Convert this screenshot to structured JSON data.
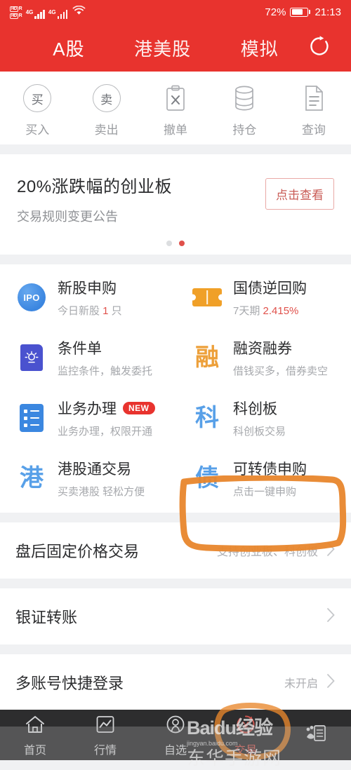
{
  "status_bar": {
    "volte_label": "HD",
    "volte_sub": "R",
    "network_1": "4G",
    "network_2": "4G",
    "wifi_icon": "wifi-icon",
    "battery_percent": "72%",
    "battery_level": 72,
    "time": "21:13"
  },
  "header": {
    "brand_color": "#e8332e",
    "tabs": [
      {
        "label": "A股",
        "active": true
      },
      {
        "label": "港美股",
        "active": false
      },
      {
        "label": "模拟",
        "active": false
      }
    ],
    "refresh_icon": "refresh-icon"
  },
  "quick_actions": [
    {
      "label": "买入",
      "glyph": "买",
      "icon": "buy-circle-icon"
    },
    {
      "label": "卖出",
      "glyph": "卖",
      "icon": "sell-circle-icon"
    },
    {
      "label": "撤单",
      "glyph": "",
      "icon": "cancel-order-clipboard-icon"
    },
    {
      "label": "持仓",
      "glyph": "",
      "icon": "holdings-database-icon"
    },
    {
      "label": "查询",
      "glyph": "",
      "icon": "query-document-icon"
    }
  ],
  "banner": {
    "title": "20%涨跌幅的创业板",
    "subtitle": "交易规则变更公告",
    "button_label": "点击查看",
    "button_border_color": "#e9a9a6",
    "button_text_color": "#c95b55",
    "dots": {
      "total": 2,
      "active_index": 1,
      "active_color": "#e0514b"
    }
  },
  "services": [
    {
      "title": "新股申购",
      "sub_prefix": "今日新股 ",
      "sub_highlight": "1",
      "sub_suffix": " 只",
      "icon": "ipo-icon",
      "icon_text": "IPO",
      "icon_color": "#3b86e0",
      "badge": ""
    },
    {
      "title": "国债逆回购",
      "sub_prefix": "7天期 ",
      "sub_highlight": "2.415%",
      "sub_suffix": "",
      "icon": "treasury-ticket-icon",
      "icon_text": "",
      "icon_color": "#f0a028",
      "badge": ""
    },
    {
      "title": "条件单",
      "sub_prefix": "监控条件，触发委托",
      "sub_highlight": "",
      "sub_suffix": "",
      "icon": "condition-order-icon",
      "icon_text": "",
      "icon_color": "#4a52cf",
      "badge": ""
    },
    {
      "title": "融资融券",
      "sub_prefix": "借钱买多，借券卖空",
      "sub_highlight": "",
      "sub_suffix": "",
      "icon": "margin-trading-icon",
      "icon_text": "融",
      "icon_color": "#eda03a",
      "badge": ""
    },
    {
      "title": "业务办理",
      "sub_prefix": "业务办理，权限开通",
      "sub_highlight": "",
      "sub_suffix": "",
      "icon": "business-list-icon",
      "icon_text": "",
      "icon_color": "#3b87e0",
      "badge": "NEW"
    },
    {
      "title": "科创板",
      "sub_prefix": "科创板交易",
      "sub_highlight": "",
      "sub_suffix": "",
      "icon": "star-market-icon",
      "icon_text": "科",
      "icon_color": "#58a0e8",
      "badge": ""
    },
    {
      "title": "港股通交易",
      "sub_prefix": "买卖港股 轻松方便",
      "sub_highlight": "",
      "sub_suffix": "",
      "icon": "hk-connect-icon",
      "icon_text": "港",
      "icon_color": "#58a0e8",
      "badge": ""
    },
    {
      "title": "可转债申购",
      "sub_prefix": "点击一键申购",
      "sub_highlight": "",
      "sub_suffix": "",
      "icon": "convertible-bond-icon",
      "icon_text": "债",
      "icon_color": "#58a0e8",
      "badge": ""
    }
  ],
  "list_rows": [
    {
      "title": "盘后固定价格交易",
      "note": "支持创业板、科创板",
      "chevron": "chevron-right-icon"
    },
    {
      "title": "银证转账",
      "note": "",
      "chevron": "chevron-right-icon"
    },
    {
      "title": "多账号快捷登录",
      "note": "未开启",
      "chevron": "chevron-right-icon"
    }
  ],
  "bottom_nav": [
    {
      "label": "首页",
      "icon": "home-icon",
      "active": false
    },
    {
      "label": "行情",
      "icon": "market-chart-icon",
      "active": false
    },
    {
      "label": "自选",
      "icon": "watchlist-person-icon",
      "active": false
    },
    {
      "label": "交易",
      "icon": "trade-yuan-icon",
      "active": true
    },
    {
      "label": "",
      "icon": "more-news-icon",
      "active": false
    }
  ],
  "annotations": {
    "color": "#e8862c",
    "highlight_target": "可转债申购",
    "nav_target": "交易"
  },
  "watermark": {
    "line1": "Baidu",
    "line1_suffix": "经验",
    "line2": "东华手游网",
    "sub": "jingyan.baidu.com"
  }
}
